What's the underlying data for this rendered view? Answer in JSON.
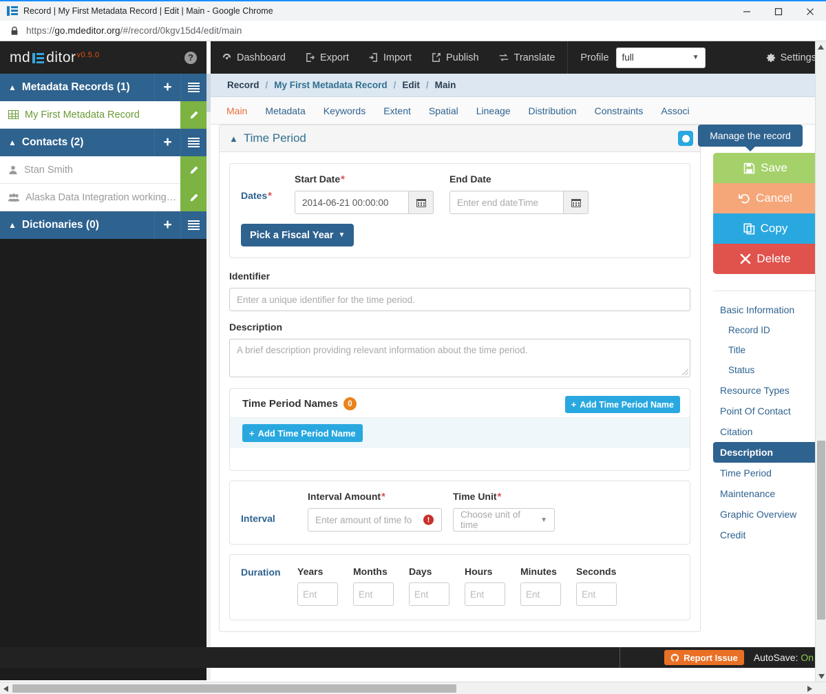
{
  "browser": {
    "tab_title": "Record | My First Metadata Record | Edit | Main - Google Chrome",
    "url_scheme": "https://",
    "url_host": "go.mdeditor.org",
    "url_path": "/#/record/0kgv15d4/edit/main",
    "minimize": "minimize-button",
    "maximize": "maximize-button",
    "close": "close-button"
  },
  "brand": {
    "name_left": "md",
    "name_right": "ditor",
    "version": "v0.5.0",
    "help": "?"
  },
  "sidebar": {
    "sections": [
      {
        "title": "Metadata Records (1)",
        "add_label": "+",
        "items": [
          {
            "label": "My First Metadata Record",
            "icon": "grid-icon",
            "edit": "pencil-icon"
          }
        ]
      },
      {
        "title": "Contacts (2)",
        "add_label": "+",
        "items": [
          {
            "label": "Stan Smith",
            "icon": "person-icon",
            "edit": "pencil-icon"
          },
          {
            "label": "Alaska Data Integration working…",
            "icon": "people-icon",
            "edit": "pencil-icon"
          }
        ]
      },
      {
        "title": "Dictionaries (0)",
        "add_label": "+",
        "items": []
      }
    ]
  },
  "topnav": {
    "items": [
      {
        "label": "Dashboard",
        "icon": "dashboard-icon"
      },
      {
        "label": "Export",
        "icon": "export-icon"
      },
      {
        "label": "Import",
        "icon": "import-icon"
      },
      {
        "label": "Publish",
        "icon": "publish-icon"
      },
      {
        "label": "Translate",
        "icon": "translate-icon"
      }
    ],
    "profile_label": "Profile",
    "profile_value": "full",
    "settings_label": "Settings"
  },
  "breadcrumb": {
    "items": [
      "Record",
      "My First Metadata Record",
      "Edit",
      "Main"
    ],
    "separator": "/"
  },
  "tabs": [
    {
      "label": "Main",
      "active": true
    },
    {
      "label": "Metadata",
      "active": false
    },
    {
      "label": "Keywords",
      "active": false
    },
    {
      "label": "Extent",
      "active": false
    },
    {
      "label": "Spatial",
      "active": false
    },
    {
      "label": "Lineage",
      "active": false
    },
    {
      "label": "Distribution",
      "active": false
    },
    {
      "label": "Constraints",
      "active": false
    },
    {
      "label": "Associ",
      "active": false
    }
  ],
  "panel": {
    "title": "Time Period",
    "toggle_icon": "toggle-on-icon"
  },
  "dates": {
    "group_label": "Dates",
    "start_label": "Start Date",
    "start_value": "2014-06-21 00:00:00",
    "end_label": "End Date",
    "end_placeholder": "Enter end dateTime",
    "calendar_icon": "calendar-icon",
    "fiscal_button": "Pick a Fiscal Year"
  },
  "identifier": {
    "label": "Identifier",
    "placeholder": "Enter a unique identifier for the time period."
  },
  "description": {
    "label": "Description",
    "placeholder": "A brief description providing relevant information about the time period."
  },
  "time_period_names": {
    "title": "Time Period Names",
    "count": "0",
    "add_button_top": "Add Time Period Name",
    "add_button_inner": "Add Time Period Name"
  },
  "interval": {
    "group_label": "Interval",
    "amount_label": "Interval Amount",
    "amount_placeholder": "Enter amount of time fo",
    "amount_error": "!",
    "unit_label": "Time Unit",
    "unit_placeholder": "Choose unit of time"
  },
  "duration": {
    "group_label": "Duration",
    "fields": [
      {
        "label": "Years",
        "placeholder": "Ent"
      },
      {
        "label": "Months",
        "placeholder": "Ent"
      },
      {
        "label": "Days",
        "placeholder": "Ent"
      },
      {
        "label": "Hours",
        "placeholder": "Ent"
      },
      {
        "label": "Minutes",
        "placeholder": "Ent"
      },
      {
        "label": "Seconds",
        "placeholder": "Ent"
      }
    ]
  },
  "manage": {
    "tooltip": "Manage the record",
    "buttons": [
      {
        "label": "Save",
        "icon": "floppy-icon",
        "color": "#a5d16b"
      },
      {
        "label": "Cancel",
        "icon": "undo-icon",
        "color": "#f5a77a"
      },
      {
        "label": "Copy",
        "icon": "copy-icon",
        "color": "#29a8e0"
      },
      {
        "label": "Delete",
        "icon": "x-icon",
        "color": "#e0524c"
      }
    ]
  },
  "section_nav": [
    {
      "label": "Basic Information",
      "level": 0,
      "active": false
    },
    {
      "label": "Record ID",
      "level": 1,
      "active": false
    },
    {
      "label": "Title",
      "level": 1,
      "active": false
    },
    {
      "label": "Status",
      "level": 1,
      "active": false
    },
    {
      "label": "Resource Types",
      "level": 0,
      "active": false
    },
    {
      "label": "Point Of Contact",
      "level": 0,
      "active": false
    },
    {
      "label": "Citation",
      "level": 0,
      "active": false
    },
    {
      "label": "Description",
      "level": 0,
      "active": true
    },
    {
      "label": "Time Period",
      "level": 0,
      "active": false
    },
    {
      "label": "Maintenance",
      "level": 0,
      "active": false
    },
    {
      "label": "Graphic Overview",
      "level": 0,
      "active": false
    },
    {
      "label": "Credit",
      "level": 0,
      "active": false
    }
  ],
  "statusbar": {
    "report_label": "Report Issue",
    "autosave_label": "AutoSave:",
    "autosave_value": "On"
  }
}
